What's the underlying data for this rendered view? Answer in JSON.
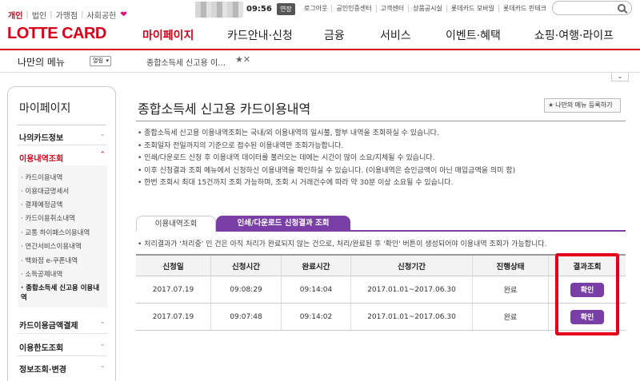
{
  "topbar": {
    "segments": [
      "개인",
      "법인",
      "가맹점",
      "사회공헌"
    ],
    "heart": "❤",
    "clock": "09:56",
    "extend_label": "연장",
    "utility_links": [
      "로그아웃",
      "공인인증센터",
      "고객센터",
      "상품공시실",
      "롯데카드 모바일",
      "롯데카드 핀테크"
    ]
  },
  "header": {
    "logo": "LOTTE CARD",
    "gnb": [
      "마이페이지",
      "카드안내·신청",
      "금융",
      "서비스",
      "이벤트·혜택",
      "쇼핑·여행·라이프"
    ],
    "active_gnb": 0
  },
  "subbar": {
    "my_menu": "나만의 메뉴",
    "open_select": "열림",
    "tab_label": "종합소득세 신고용 이…",
    "tab_icons": "★✕",
    "collapse_glyph": "⌄"
  },
  "sidebar": {
    "title": "마이페이지",
    "sections": [
      {
        "label": "나의카드정보",
        "chevron": "⌄"
      },
      {
        "label": "이용내역조회",
        "chevron": "⌃",
        "open": true
      },
      {
        "label": "카드이용금액결제",
        "chevron": "⌄"
      },
      {
        "label": "이용한도조회",
        "chevron": "⌄"
      },
      {
        "label": "정보조회·변경",
        "chevron": "⌄"
      }
    ],
    "sub_items": [
      "카드이용내역",
      "이용대금명세서",
      "결제예정금액",
      "카드이용취소내역",
      "교통 하이패스이용내역",
      "연간서비스이용내역",
      "백화점 e-쿠폰내역",
      "소득공제내역",
      "종합소득세 신고용 이용내역"
    ],
    "current_sub": 8
  },
  "main": {
    "title": "종합소득세 신고용 카드이용내역",
    "register_button": "나만의 메뉴 등록하기",
    "notes": [
      "종합소득세 신고용 이용내역조회는 국내/외 이용내역의 일시불, 할부 내역을 조회하실 수 있습니다.",
      "조회일자 전일까지의 기준으로 접수된 이용내역만 조회가능합니다.",
      "인쇄/다운로드 신청 후 이용내역 데이터를 불러오는 데에는 시간이 많이 소요/지체될 수 있습니다.",
      "이후 신청결과 조회 메뉴에서 신청하신 이용내역을 확인하실 수 있습니다. (이용내역은 승인금액이 아닌 매입금액을 의미 함)",
      "한번 조회시 최대 15건까지 조회 가능하며, 조회 시 거래건수에 따라 약 30분 이상 소요될 수 있습니다."
    ],
    "tabs": [
      "이용내역조회",
      "인쇄/다운로드 신청결과 조회"
    ],
    "active_tab": 1,
    "process_note": "• 처리결과가 '처리중' 인 건은 아직 처리가 완료되지 않는 건으로, 처리/완료된 후 '확인' 버튼이 생성되어야 이용내역 조회가 가능합니다.",
    "table": {
      "headers": [
        "신청일",
        "신청시간",
        "완료시간",
        "신청기간",
        "진행상태",
        "결과조회"
      ],
      "rows": [
        [
          "2017.07.19",
          "09:08:29",
          "09:14:04",
          "2017.01.01~2017.06.30",
          "완료",
          "확인"
        ],
        [
          "2017.07.19",
          "09:07:48",
          "09:14:02",
          "2017.01.01~2017.06.30",
          "완료",
          "확인"
        ]
      ]
    }
  },
  "colors": {
    "brand_red": "#d9001b",
    "purple": "#7a3fa6",
    "highlight_red": "#e4001b"
  }
}
